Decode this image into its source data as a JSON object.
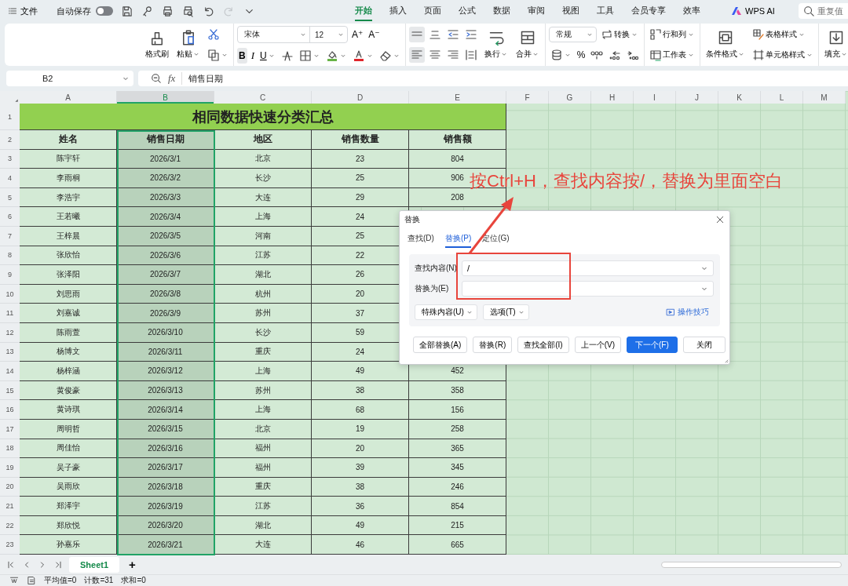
{
  "top_bar": {
    "menu_label": "文件",
    "autosave": {
      "label": "自动保存",
      "on": false
    },
    "quick_access": [
      {
        "disabled": false
      },
      {
        "disabled": false
      },
      {
        "disabled": false
      },
      {
        "disabled": false
      },
      {
        "disabled": false
      },
      {
        "disabled": true
      },
      {
        "disabled": false
      }
    ],
    "tabs": [
      {
        "label": "开始",
        "selected": true
      },
      {
        "label": "插入",
        "selected": false
      },
      {
        "label": "页面",
        "selected": false
      },
      {
        "label": "公式",
        "selected": false
      },
      {
        "label": "数据",
        "selected": false
      },
      {
        "label": "审阅",
        "selected": false
      },
      {
        "label": "视图",
        "selected": false
      },
      {
        "label": "工具",
        "selected": false
      },
      {
        "label": "会员专享",
        "selected": false
      },
      {
        "label": "效率",
        "selected": false
      }
    ],
    "ai_label": "WPS AI",
    "search": {
      "placeholder": "重复值"
    }
  },
  "ribbon": {
    "groups": [
      {
        "cols": [
          {
            "kind": "large",
            "label": "格式刷",
            "caret": false
          },
          {
            "kind": "large",
            "label": "粘贴",
            "caret": true
          },
          {
            "kind": "stack",
            "top": [
              {
                "kind": "icon",
                "caret": false,
                "on": false
              }
            ],
            "bottom": [
              {
                "kind": "icon",
                "caret": true,
                "on": false
              }
            ]
          }
        ]
      },
      {
        "cols": [
          {
            "kind": "stack",
            "top": [
              {
                "kind": "font",
                "family": "宋体",
                "size": "12"
              },
              {
                "kind": "glyph",
                "label": "A⁺",
                "caret": false,
                "on": false
              },
              {
                "kind": "glyph",
                "label": "A⁻",
                "caret": false,
                "on": false
              }
            ],
            "bottom": [
              {
                "kind": "glyph",
                "label": "B",
                "caret": false,
                "on": true
              },
              {
                "kind": "glyph",
                "label": "I",
                "caret": false,
                "on": false
              },
              {
                "kind": "glyph",
                "label": "U",
                "caret": true,
                "on": false
              },
              {
                "kind": "icon",
                "caret": false,
                "on": false
              },
              {
                "kind": "icon",
                "caret": true,
                "on": false
              },
              {
                "kind": "icon",
                "caret": true,
                "on": false
              },
              {
                "kind": "icon",
                "caret": true,
                "on": false
              },
              {
                "kind": "icon",
                "caret": true,
                "on": false
              }
            ]
          }
        ]
      },
      {
        "cols": [
          {
            "kind": "stack",
            "top": [
              {
                "kind": "icon",
                "caret": false,
                "on": true
              },
              {
                "kind": "icon",
                "caret": false,
                "on": false
              },
              {
                "kind": "icon",
                "caret": false,
                "on": false
              },
              {
                "kind": "icon",
                "caret": false,
                "on": false
              }
            ],
            "bottom": [
              {
                "kind": "icon",
                "caret": false,
                "on": true
              },
              {
                "kind": "icon",
                "caret": false,
                "on": false
              },
              {
                "kind": "icon",
                "caret": false,
                "on": false
              },
              {
                "kind": "icon",
                "caret": false,
                "on": false
              }
            ]
          },
          {
            "kind": "large",
            "label": "换行",
            "caret": true
          },
          {
            "kind": "large",
            "label": "合并",
            "caret": true
          }
        ]
      },
      {
        "cols": [
          {
            "kind": "stack",
            "top": [
              {
                "kind": "select",
                "value": "常规"
              },
              {
                "kind": "text",
                "label": "转换",
                "caret": true
              }
            ],
            "bottom": [
              {
                "kind": "icon",
                "caret": true,
                "on": false
              },
              {
                "kind": "glyph",
                "label": "%",
                "caret": false,
                "on": false
              },
              {
                "kind": "icon",
                "caret": false,
                "on": false
              },
              {
                "kind": "icon",
                "caret": false,
                "on": false
              },
              {
                "kind": "icon",
                "caret": false,
                "on": false
              }
            ]
          }
        ]
      },
      {
        "cols": [
          {
            "kind": "stack",
            "top": [
              {
                "kind": "text",
                "label": "行和列",
                "caret": true
              }
            ],
            "bottom": [
              {
                "kind": "text",
                "label": "工作表",
                "caret": true
              }
            ]
          }
        ]
      },
      {
        "cols": [
          {
            "kind": "large",
            "label": "条件格式",
            "caret": true
          },
          {
            "kind": "stack",
            "top": [
              {
                "kind": "text",
                "label": "表格样式",
                "caret": true
              }
            ],
            "bottom": [
              {
                "kind": "text",
                "label": "单元格样式",
                "caret": true
              }
            ]
          }
        ]
      },
      {
        "cols": [
          {
            "kind": "large",
            "label": "填充",
            "caret": true
          }
        ]
      }
    ]
  },
  "formula_bar": {
    "name_box": "B2",
    "fx_label": "fx",
    "formula": "销售日期"
  },
  "sheet": {
    "columns": [
      {
        "label": "A",
        "selected": false
      },
      {
        "label": "B",
        "selected": true
      },
      {
        "label": "C",
        "selected": false
      },
      {
        "label": "D",
        "selected": false
      },
      {
        "label": "E",
        "selected": false
      },
      {
        "label": "F",
        "selected": false
      },
      {
        "label": "G",
        "selected": false
      },
      {
        "label": "H",
        "selected": false
      },
      {
        "label": "I",
        "selected": false
      },
      {
        "label": "J",
        "selected": false
      },
      {
        "label": "K",
        "selected": false
      },
      {
        "label": "L",
        "selected": false
      },
      {
        "label": "M",
        "selected": false
      }
    ],
    "title_row_number": "1",
    "title": "相同数据快速分类汇总",
    "header_row_number": "2",
    "headers": [
      "姓名",
      "销售日期",
      "地区",
      "销售数量",
      "销售额"
    ],
    "rows": [
      {
        "row_number": "3",
        "cells": [
          "陈宇轩",
          "2026/3/1",
          "北京",
          "23",
          "804"
        ]
      },
      {
        "row_number": "4",
        "cells": [
          "李雨桐",
          "2026/3/2",
          "长沙",
          "25",
          "906"
        ]
      },
      {
        "row_number": "5",
        "cells": [
          "李浩宇",
          "2026/3/3",
          "大连",
          "29",
          "208"
        ]
      },
      {
        "row_number": "6",
        "cells": [
          "王若曦",
          "2026/3/4",
          "上海",
          "24"
        ]
      },
      {
        "row_number": "7",
        "cells": [
          "王梓晨",
          "2026/3/5",
          "河南",
          "25"
        ]
      },
      {
        "row_number": "8",
        "cells": [
          "张欣怡",
          "2026/3/6",
          "江苏",
          "22"
        ]
      },
      {
        "row_number": "9",
        "cells": [
          "张泽阳",
          "2026/3/7",
          "湖北",
          "26"
        ]
      },
      {
        "row_number": "10",
        "cells": [
          "刘思雨",
          "2026/3/8",
          "杭州",
          "20"
        ]
      },
      {
        "row_number": "11",
        "cells": [
          "刘嘉诚",
          "2026/3/9",
          "苏州",
          "37"
        ]
      },
      {
        "row_number": "12",
        "cells": [
          "陈雨萱",
          "2026/3/10",
          "长沙",
          "59"
        ]
      },
      {
        "row_number": "13",
        "cells": [
          "杨博文",
          "2026/3/11",
          "重庆",
          "24"
        ]
      },
      {
        "row_number": "14",
        "cells": [
          "杨梓涵",
          "2026/3/12",
          "上海",
          "49",
          "452"
        ]
      },
      {
        "row_number": "15",
        "cells": [
          "黄俊豪",
          "2026/3/13",
          "苏州",
          "38",
          "358"
        ]
      },
      {
        "row_number": "16",
        "cells": [
          "黄诗琪",
          "2026/3/14",
          "上海",
          "68",
          "156"
        ]
      },
      {
        "row_number": "17",
        "cells": [
          "周明哲",
          "2026/3/15",
          "北京",
          "19",
          "258"
        ]
      },
      {
        "row_number": "18",
        "cells": [
          "周佳怡",
          "2026/3/16",
          "福州",
          "20",
          "365"
        ]
      },
      {
        "row_number": "19",
        "cells": [
          "吴子豪",
          "2026/3/17",
          "福州",
          "39",
          "345"
        ]
      },
      {
        "row_number": "20",
        "cells": [
          "吴雨欣",
          "2026/3/18",
          "重庆",
          "38",
          "246"
        ]
      },
      {
        "row_number": "21",
        "cells": [
          "郑泽宇",
          "2026/3/19",
          "江苏",
          "36",
          "854"
        ]
      },
      {
        "row_number": "22",
        "cells": [
          "郑欣悦",
          "2026/3/20",
          "湖北",
          "49",
          "215"
        ]
      },
      {
        "row_number": "23",
        "cells": [
          "孙嘉乐",
          "2026/3/21",
          "大连",
          "46",
          "665"
        ]
      }
    ]
  },
  "dialog": {
    "title": "替换",
    "tabs": [
      {
        "label": "查找(D)",
        "selected": false
      },
      {
        "label": "替换(P)",
        "selected": true
      },
      {
        "label": "定位(G)",
        "selected": false
      }
    ],
    "fields": [
      {
        "label": "查找内容(N)",
        "value": "/"
      },
      {
        "label": "替换为(E)"
      }
    ],
    "option_buttons": [
      "特殊内容(U)",
      "选项(T)"
    ],
    "tips_link": "操作技巧",
    "buttons": [
      {
        "label": "全部替换(A)",
        "primary": false
      },
      {
        "label": "替换(R)",
        "primary": false
      },
      {
        "label": "查找全部(I)",
        "primary": false
      },
      {
        "label": "上一个(V)",
        "primary": false
      },
      {
        "label": "下一个(F)",
        "primary": true
      },
      {
        "label": "关闭",
        "primary": false
      }
    ]
  },
  "annotation": {
    "text": "按Ctrl+H，查找内容按/，替换为里面空白"
  },
  "sheet_tabs": [
    {
      "label": "Sheet1",
      "selected": true
    }
  ],
  "add_sheet_label": "+",
  "status_bar": {
    "items": [
      "平均值=0",
      "计数=31",
      "求和=0"
    ]
  }
}
